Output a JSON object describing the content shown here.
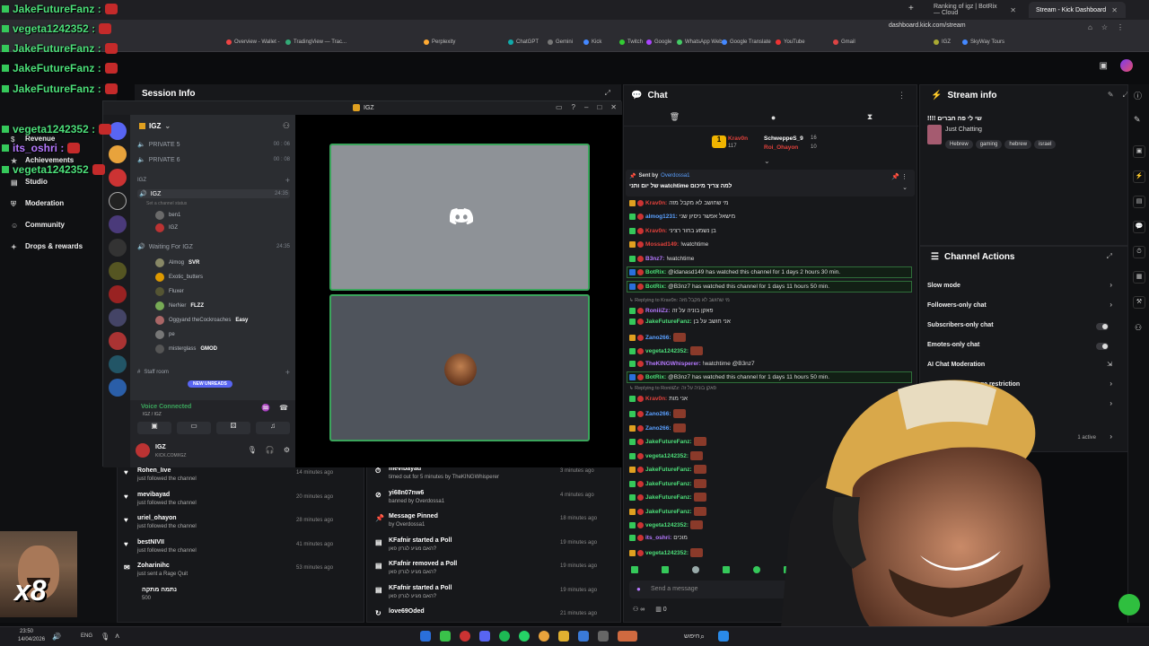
{
  "browser": {
    "tabs": [
      {
        "label": "Ranking of igz | BotRix — Cloud"
      },
      {
        "label": "Stream - Kick Dashboard"
      }
    ],
    "address": "dashboard.kick.com/stream",
    "bookmarks": [
      "Overview - Wallet -",
      "TradingView — Trac...",
      "Perplexity",
      "ChatGPT",
      "Gemini",
      "Kick",
      "Twitch",
      "Google",
      "WhatsApp Web",
      "Google Translate",
      "YouTube",
      "Gmail",
      "IGZ",
      "SkyWay Tours"
    ]
  },
  "overlay_chat": [
    {
      "user": "JakeFutureFanz :",
      "color": "green"
    },
    {
      "user": "vegeta1242352 :",
      "color": "green"
    },
    {
      "user": "JakeFutureFanz :",
      "color": "green"
    },
    {
      "user": "JakeFutureFanz :",
      "color": "green"
    },
    {
      "user": "JakeFutureFanz :",
      "color": "green"
    },
    {
      "user": "vegeta1242352 :",
      "color": "green"
    },
    {
      "user": "its_oshri :",
      "color": "purple"
    },
    {
      "user": "vegeta1242352",
      "color": "green"
    }
  ],
  "nav": {
    "items": [
      {
        "label": "Revenue"
      },
      {
        "label": "Achievements"
      },
      {
        "label": "Studio"
      },
      {
        "label": "Moderation"
      },
      {
        "label": "Community"
      },
      {
        "label": "Drops & rewards"
      }
    ]
  },
  "session": {
    "title": "Session Info"
  },
  "discord": {
    "window_title": "IGZ",
    "server": "IGZ",
    "channels": [
      {
        "name": "PRIVATE 5",
        "count": "00 : 06"
      },
      {
        "name": "PRIVATE 6",
        "count": "00 : 08"
      },
      {
        "name": "IGZ",
        "count": "24:35"
      }
    ],
    "category": "IGZ",
    "channel_status": "Set a channel status",
    "voice_users_1": [
      "ben1",
      "IGZ"
    ],
    "waiting_channel": "Waiting For IGZ",
    "waiting_time": "24:35",
    "voice_users_2": [
      {
        "name": "Almog",
        "tag": "SVR"
      },
      {
        "name": "Exotic_butters",
        "tag": ""
      },
      {
        "name": "Fluxer",
        "tag": ""
      },
      {
        "name": "NerNer",
        "tag": "FLZZ"
      },
      {
        "name": "Oggyand theCockroaches",
        "tag": "Easy"
      },
      {
        "name": "pe",
        "tag": ""
      },
      {
        "name": "misterglass",
        "tag": "GMOD"
      }
    ],
    "staff_room": "Staff room",
    "new_unreads": "NEW UNREADS",
    "voice_connected": "Voice Connected",
    "voice_sub": "IGZ / IGZ",
    "user_name": "IGZ",
    "user_status": "KICK.COM/IGZ"
  },
  "activity_left": [
    {
      "user": "Rohen_live",
      "sub": "just followed the channel",
      "time": "14 minutes ago"
    },
    {
      "user": "mevibayad",
      "sub": "just followed the channel",
      "time": "20 minutes ago"
    },
    {
      "user": "uriel_ohayon",
      "sub": "just followed the channel",
      "time": "28 minutes ago"
    },
    {
      "user": "bestNIVII",
      "sub": "just followed the channel",
      "time": "41 minutes ago"
    },
    {
      "user": "Zoharinihc",
      "sub": "just sent a Rage Quit",
      "time": "53 minutes ago"
    },
    {
      "user": "נתמה מתקה",
      "sub": "500",
      "time": ""
    }
  ],
  "activity_right": [
    {
      "user": "mevibayad",
      "sub": "timed out for 5 minutes by TheKINGWhisperer",
      "time": "3 minutes ago"
    },
    {
      "user": "yi68n07nw6",
      "sub": "banned by Overdossa1",
      "time": "4 minutes ago"
    },
    {
      "user": "Message Pinned",
      "sub": "by Overdossa1",
      "time": "18 minutes ago"
    },
    {
      "user": "KFafnir started a Poll",
      "sub": "האם מגיע לגרזן פאן?",
      "time": "19 minutes ago"
    },
    {
      "user": "KFafnir removed a Poll",
      "sub": "האם מגיע לגרזן פאן?",
      "time": "19 minutes ago"
    },
    {
      "user": "KFafnir started a Poll",
      "sub": "האם מגיע לגרזן פאן?",
      "time": "19 minutes ago"
    },
    {
      "user": "love69Oded",
      "sub": "",
      "time": "21 minutes ago"
    }
  ],
  "chat": {
    "title": "Chat",
    "top_users": [
      {
        "name": "Krav0n",
        "count": "117"
      },
      {
        "name": "SchweppeS_9",
        "count": "16"
      },
      {
        "name": "Roi_Ohayon",
        "count": "10"
      }
    ],
    "pinned_by_label": "Sent by",
    "pinned_by": "Overdossa1",
    "pinned_text": "של יום ותני watchtime למה צריך מיכום",
    "messages": [
      {
        "user": "Krav0n",
        "color": "#e0413b",
        "text": "מי שחושב לא מקבל מזה"
      },
      {
        "user": "almog1231",
        "color": "#5aa0ff",
        "text": "מישאל אפשר ניסיון שני"
      },
      {
        "user": "Krav0n",
        "color": "#e0413b",
        "text": "בן נשמע בחור רציני"
      },
      {
        "user": "Mossad149",
        "color": "#e0413b",
        "text": "!watchtime"
      },
      {
        "user": "B3nz7",
        "color": "#b679ff",
        "text": "!watchtime"
      },
      {
        "user": "BotRix",
        "color": "#4ddf7a",
        "text": "@idanasd149 has watched this channel for 1 days 2 hours 30 min."
      },
      {
        "user": "BotRix",
        "color": "#4ddf7a",
        "text": "@B3nz7 has watched this channel for 1 days 11 hours 50 min."
      },
      {
        "user": "RoniiiZz",
        "color": "#b679ff",
        "text": "פאקן בוניה על זה"
      },
      {
        "user": "JakeFutureFanz",
        "color": "#4ddf7a",
        "text": "אני חושב על בן"
      },
      {
        "user": "Zano266",
        "color": "#5aa0ff",
        "text": ""
      },
      {
        "user": "vegeta1242352",
        "color": "#4ddf7a",
        "text": ""
      },
      {
        "user": "TheKINGWhisperer",
        "color": "#b679ff",
        "text": "!watchtime @B3nz7"
      },
      {
        "user": "BotRix",
        "color": "#4ddf7a",
        "text": "@B3nz7 has watched this channel for 1 days 11 hours 50 min."
      },
      {
        "user": "Krav0n",
        "color": "#e0413b",
        "text": "אני מות"
      },
      {
        "user": "Zano266",
        "color": "#5aa0ff",
        "text": ""
      },
      {
        "user": "Zano266",
        "color": "#5aa0ff",
        "text": ""
      },
      {
        "user": "JakeFutureFanz",
        "color": "#4ddf7a",
        "text": ""
      },
      {
        "user": "vegeta1242352",
        "color": "#4ddf7a",
        "text": ""
      },
      {
        "user": "JakeFutureFanz",
        "color": "#4ddf7a",
        "text": ""
      },
      {
        "user": "JakeFutureFanz",
        "color": "#4ddf7a",
        "text": ""
      },
      {
        "user": "JakeFutureFanz",
        "color": "#4ddf7a",
        "text": ""
      },
      {
        "user": "JakeFutureFanz",
        "color": "#4ddf7a",
        "text": ""
      },
      {
        "user": "vegeta1242352",
        "color": "#4ddf7a",
        "text": ""
      },
      {
        "user": "its_oshri",
        "color": "#b679ff",
        "text": "מוכים"
      },
      {
        "user": "vegeta1242352",
        "color": "#4ddf7a",
        "text": ""
      }
    ],
    "replying_1": "Replying to Krav0n: מי שחושב לא מקבל מזה",
    "replying_2": "Replying to RoniiiZz: פאקן בוניה על זה",
    "input_placeholder": "Send a message",
    "viewers": "0"
  },
  "stream_info": {
    "title": "Stream info",
    "stream_title": "!!!! שי לי פה חברים",
    "category": "Just Chatting",
    "tags": [
      "Hebrew",
      "gaming",
      "hebrew",
      "israel"
    ]
  },
  "channel_actions": {
    "title": "Channel Actions",
    "items": [
      {
        "label": "Slow mode",
        "control": "arrow"
      },
      {
        "label": "Followers-only chat",
        "control": "arrow"
      },
      {
        "label": "Subscribers-only chat",
        "control": "toggle"
      },
      {
        "label": "Emotes-only chat",
        "control": "toggle"
      },
      {
        "label": "AI Chat Moderation",
        "control": "external"
      },
      {
        "label": "...ount age restriction",
        "control": "arrow"
      }
    ],
    "active": "1 active"
  },
  "taskbar": {
    "time": "23:50",
    "date": "14/04/2026",
    "lang": "ENG",
    "search": "חיפוש"
  },
  "facecam": {
    "multiplier": "x8"
  },
  "colors": {
    "kick_green": "#53fc18",
    "discord_green": "#3ba55c",
    "accent_purple": "#b679ff"
  }
}
